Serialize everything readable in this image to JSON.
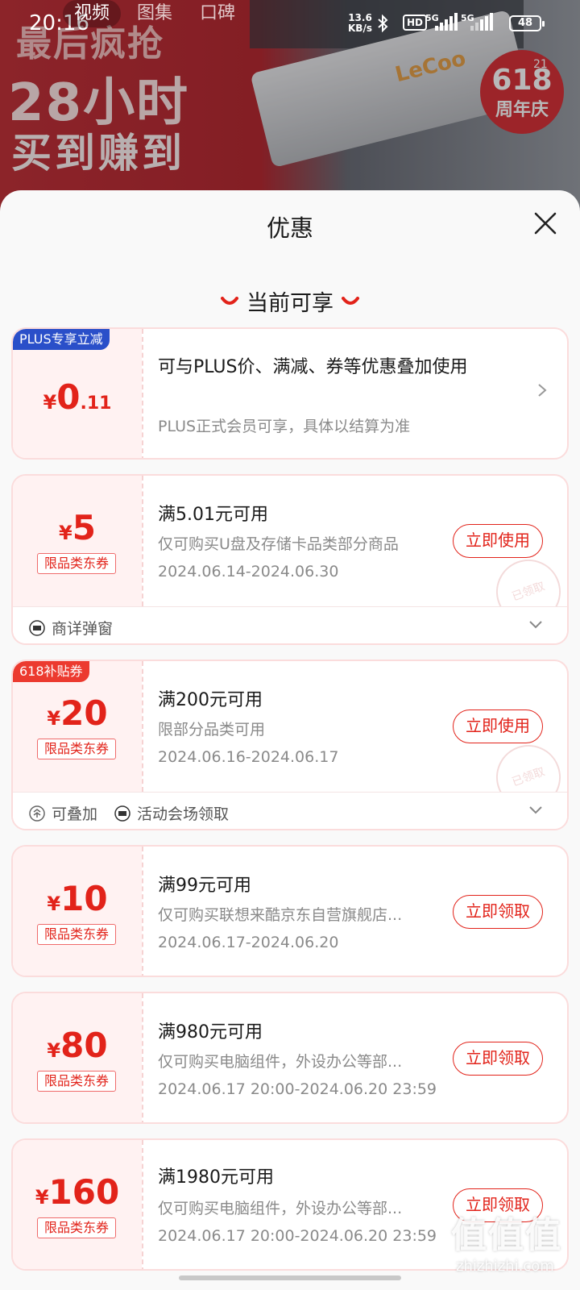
{
  "status_bar": {
    "time": "20:16",
    "net_speed_value": "13.6",
    "net_speed_unit": "KB/s",
    "hd_label": "HD",
    "sim1_label": "5G",
    "sim2_label": "5G",
    "battery": "48"
  },
  "top_tabs": [
    {
      "label": "视频"
    },
    {
      "label": "图集"
    },
    {
      "label": "口碑"
    }
  ],
  "banner": {
    "slogan_line1": "最后疯抢",
    "slogan_line2": "28小时",
    "slogan_line3": "买到赚到",
    "product_logo": "LeCoo",
    "badge_top": "21",
    "badge_number": "618",
    "badge_text": "周年庆"
  },
  "sheet": {
    "title": "优惠",
    "section_title": "当前可享"
  },
  "coupons": [
    {
      "corner_label": "PLUS专享立减",
      "currency": "¥",
      "amount_int": "0",
      "amount_dec": ".11",
      "title": "可与PLUS价、满减、券等优惠叠加使用",
      "subtitle": "PLUS正式会员可享，具体以结算为准"
    },
    {
      "currency": "¥",
      "amount": "5",
      "tag": "限品类东券",
      "title": "满5.01元可用",
      "subtitle": "仅可购买U盘及存储卡品类部分商品",
      "date": "2024.06.14-2024.06.30",
      "button": "立即使用",
      "stamp": "已领取",
      "footer": [
        {
          "label": "商详弹窗"
        }
      ]
    },
    {
      "corner_label": "618补贴券",
      "currency": "¥",
      "amount": "20",
      "tag": "限品类东券",
      "title": "满200元可用",
      "subtitle": "限部分品类可用",
      "date": "2024.06.16-2024.06.17",
      "button": "立即使用",
      "stamp": "已领取",
      "footer": [
        {
          "label": "可叠加"
        },
        {
          "label": "活动会场领取"
        }
      ]
    },
    {
      "currency": "¥",
      "amount": "10",
      "tag": "限品类东券",
      "title": "满99元可用",
      "subtitle": "仅可购买联想来酷京东自营旗舰店...",
      "date": "2024.06.17-2024.06.20",
      "button": "立即领取"
    },
    {
      "currency": "¥",
      "amount": "80",
      "tag": "限品类东券",
      "title": "满980元可用",
      "subtitle": "仅可购买电脑组件，外设办公等部...",
      "date": "2024.06.17 20:00-2024.06.20 23:59",
      "button": "立即领取"
    },
    {
      "currency": "¥",
      "amount": "160",
      "tag": "限品类东券",
      "title": "满1980元可用",
      "subtitle": "仅可购买电脑组件，外设办公等部...",
      "date": "2024.06.17 20:00-2024.06.20 23:59",
      "button": "立即领取"
    }
  ],
  "watermark": {
    "text": "值值值",
    "url": "zhizhizhi.com"
  },
  "colors": {
    "accent": "#e2231a",
    "plus_blue": "#2a4fc9",
    "card_left_bg": "#fff2f2",
    "card_border": "#fbdcdc"
  }
}
